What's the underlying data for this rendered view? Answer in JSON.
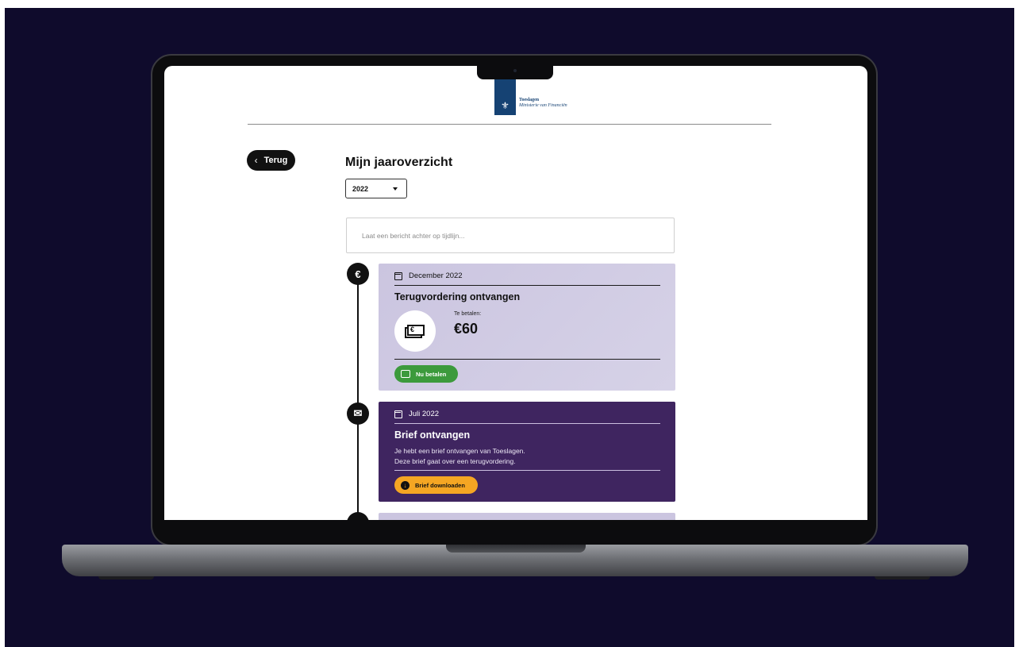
{
  "header": {
    "logo_line1": "Toeslagen",
    "logo_line2": "Ministerie van Financiën",
    "logo_color": "#154273"
  },
  "back_button": {
    "label": "Terug"
  },
  "page": {
    "title": "Mijn jaaroverzicht",
    "year_select": {
      "selected": "2022"
    },
    "message_input": {
      "placeholder": "Laat een bericht achter op tijdlijn..."
    }
  },
  "timeline": {
    "items": [
      {
        "icon": "euro-icon",
        "node_glyph": "€",
        "date": "December 2022",
        "title": "Terugvordering ontvangen",
        "pay_label": "Te betalen:",
        "amount": "€60",
        "button_label": "Nu betalen",
        "bg_color": "#cbc5e0",
        "button_color": "#3c9a3c"
      },
      {
        "icon": "mail-icon",
        "node_glyph": "✉",
        "date": "Juli 2022",
        "title": "Brief ontvangen",
        "text_line1": "Je hebt een brief ontvangen van Toeslagen.",
        "text_line2": "Deze brief gaat over een terugvordering.",
        "button_label": "Brief downloaden",
        "bg_color": "#3f2560",
        "button_color": "#f5a623"
      }
    ]
  },
  "colors": {
    "background": "#0f0b2c",
    "accent_dark": "#111111"
  }
}
